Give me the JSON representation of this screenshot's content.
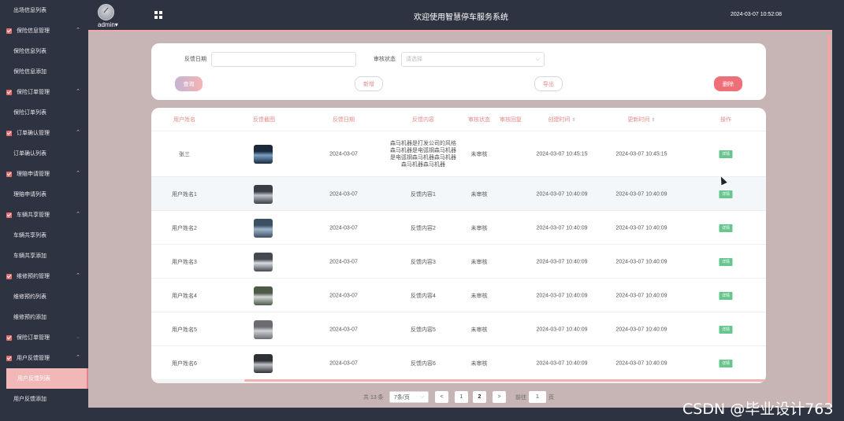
{
  "sidebar": {
    "items": [
      {
        "type": "sub",
        "label": "出场信息列表"
      },
      {
        "type": "group",
        "label": "保险信息管理",
        "arrow": "up"
      },
      {
        "type": "sub",
        "label": "保险信息列表"
      },
      {
        "type": "sub",
        "label": "保险信息添加"
      },
      {
        "type": "group",
        "label": "保险订单管理",
        "arrow": "up"
      },
      {
        "type": "sub",
        "label": "保险订单列表"
      },
      {
        "type": "group",
        "label": "订单确认管理",
        "arrow": "up"
      },
      {
        "type": "sub",
        "label": "订单确认列表"
      },
      {
        "type": "group",
        "label": "理赔申请管理",
        "arrow": "up"
      },
      {
        "type": "sub",
        "label": "理赔申请列表"
      },
      {
        "type": "group",
        "label": "车辆共享管理",
        "arrow": "up"
      },
      {
        "type": "sub",
        "label": "车辆共享列表"
      },
      {
        "type": "sub",
        "label": "车辆共享添加"
      },
      {
        "type": "group",
        "label": "维修预约管理",
        "arrow": "up"
      },
      {
        "type": "sub",
        "label": "维修预约列表"
      },
      {
        "type": "sub",
        "label": "维修预约添加"
      },
      {
        "type": "group",
        "label": "保险订单管理",
        "arrow": "down"
      },
      {
        "type": "group",
        "label": "用户反馈管理",
        "arrow": "up"
      },
      {
        "type": "sub",
        "label": "用户反馈列表",
        "active": true
      },
      {
        "type": "sub",
        "label": "用户反馈添加"
      }
    ]
  },
  "header": {
    "username": "admin",
    "title": "欢迎使用智慧停车服务系统",
    "datetime": "2024-03-07 10:52:08"
  },
  "filter": {
    "date_label": "反馈日期",
    "date_value": "",
    "status_label": "审核状态",
    "status_placeholder": "请选择",
    "query_label": "查询",
    "add_label": "新增",
    "export_label": "导出",
    "delete_label": "删除"
  },
  "table": {
    "headers": {
      "name": "用户姓名",
      "image": "反馈截图",
      "date": "反馈日期",
      "content": "反馈内容",
      "status": "审核状态",
      "reply": "审核回复",
      "created": "创建时间",
      "updated": "更新时间",
      "action": "操作"
    },
    "rows": [
      {
        "name": "张三",
        "date": "2024-03-07",
        "content": "森马机器是打发公司的风格森马机器是电弧钢森马机器是电弧钢森马机器森马机器森马机器森马机器",
        "status": "未审核",
        "created": "2024-03-07 10:45:15",
        "updated": "2024-03-07 10:45:15",
        "action": "详情"
      },
      {
        "name": "用户姓名1",
        "date": "2024-03-07",
        "content": "反馈内容1",
        "status": "未审核",
        "created": "2024-03-07 10:40:09",
        "updated": "2024-03-07 10:40:09",
        "action": "详情"
      },
      {
        "name": "用户姓名2",
        "date": "2024-03-07",
        "content": "反馈内容2",
        "status": "未审核",
        "created": "2024-03-07 10:40:09",
        "updated": "2024-03-07 10:40:09",
        "action": "详情"
      },
      {
        "name": "用户姓名3",
        "date": "2024-03-07",
        "content": "反馈内容3",
        "status": "未审核",
        "created": "2024-03-07 10:40:09",
        "updated": "2024-03-07 10:40:09",
        "action": "详情"
      },
      {
        "name": "用户姓名4",
        "date": "2024-03-07",
        "content": "反馈内容4",
        "status": "未审核",
        "created": "2024-03-07 10:40:09",
        "updated": "2024-03-07 10:40:09",
        "action": "详情"
      },
      {
        "name": "用户姓名5",
        "date": "2024-03-07",
        "content": "反馈内容5",
        "status": "未审核",
        "created": "2024-03-07 10:40:09",
        "updated": "2024-03-07 10:40:09",
        "action": "详情"
      },
      {
        "name": "用户姓名6",
        "date": "2024-03-07",
        "content": "反馈内容6",
        "status": "未审核",
        "created": "2024-03-07 10:40:09",
        "updated": "2024-03-07 10:40:09",
        "action": "详情"
      }
    ]
  },
  "pagination": {
    "total": "共 13 条",
    "page_size": "7条/页",
    "prev": "<",
    "pages": [
      "1",
      "2"
    ],
    "current": "2",
    "next": ">",
    "goto_label": "前往",
    "goto_value": "1",
    "goto_suffix": "页"
  },
  "watermark": "CSDN @毕业设计763",
  "colors": {
    "sidebar_bg": "#2d3340",
    "accent": "#e38a8a",
    "delete": "#ef6f78",
    "detail": "#67c58e",
    "page_bg": "#c7b5b5"
  }
}
